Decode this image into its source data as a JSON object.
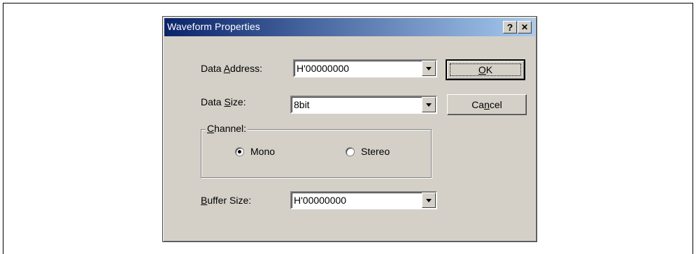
{
  "dialog": {
    "title": "Waveform Properties",
    "help_glyph": "?",
    "close_glyph": "✕"
  },
  "fields": {
    "data_address": {
      "label_prefix": "Data ",
      "label_mnemonic": "A",
      "label_suffix": "ddress:",
      "value": "H'00000000"
    },
    "data_size": {
      "label_prefix": "Data ",
      "label_mnemonic": "S",
      "label_suffix": "ize:",
      "value": "8bit"
    },
    "buffer_size": {
      "label_prefix": "",
      "label_mnemonic": "B",
      "label_suffix": "uffer Size:",
      "value": "H'00000000"
    }
  },
  "channel": {
    "legend_mnemonic": "C",
    "legend_suffix": "hannel:",
    "options": [
      {
        "label": "Mono",
        "selected": true
      },
      {
        "label": "Stereo",
        "selected": false
      }
    ]
  },
  "buttons": {
    "ok_mnemonic": "O",
    "ok_suffix": "K",
    "cancel_prefix": "Ca",
    "cancel_mnemonic": "n",
    "cancel_suffix": "cel"
  }
}
